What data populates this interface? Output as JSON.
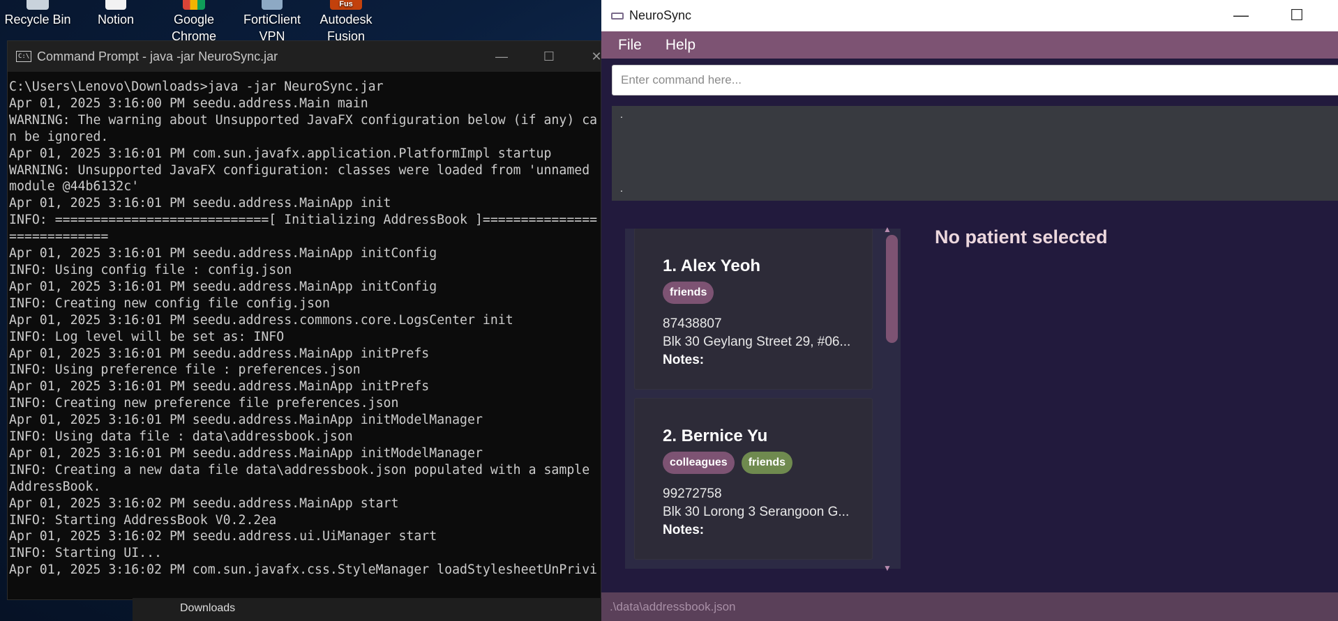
{
  "desktop": {
    "icons": [
      {
        "label": "Recycle Bin",
        "name": "recycle-bin-icon"
      },
      {
        "label": "Notion",
        "name": "notion-icon"
      },
      {
        "label": "Google Chrome",
        "line1": "Google",
        "line2": "Chrome",
        "name": "chrome-icon"
      },
      {
        "label": "FortiClient VPN",
        "line1": "FortiClient",
        "line2": "VPN",
        "name": "forticlient-icon"
      },
      {
        "label": "Autodesk Fusion",
        "line1": "Autodesk",
        "line2": "Fusion",
        "badge": "Fus",
        "name": "fusion-icon"
      }
    ]
  },
  "cmd": {
    "title": "Command Prompt - java  -jar NeuroSync.jar",
    "lines": [
      "C:\\Users\\Lenovo\\Downloads>java -jar NeuroSync.jar",
      "Apr 01, 2025 3:16:00 PM seedu.address.Main main",
      "WARNING: The warning about Unsupported JavaFX configuration below (if any) ca",
      "n be ignored.",
      "Apr 01, 2025 3:16:01 PM com.sun.javafx.application.PlatformImpl startup",
      "WARNING: Unsupported JavaFX configuration: classes were loaded from 'unnamed",
      "module @44b6132c'",
      "Apr 01, 2025 3:16:01 PM seedu.address.MainApp init",
      "INFO: ============================[ Initializing AddressBook ]===============",
      "=============",
      "Apr 01, 2025 3:16:01 PM seedu.address.MainApp initConfig",
      "INFO: Using config file : config.json",
      "Apr 01, 2025 3:16:01 PM seedu.address.MainApp initConfig",
      "INFO: Creating new config file config.json",
      "Apr 01, 2025 3:16:01 PM seedu.address.commons.core.LogsCenter init",
      "INFO: Log level will be set as: INFO",
      "Apr 01, 2025 3:16:01 PM seedu.address.MainApp initPrefs",
      "INFO: Using preference file : preferences.json",
      "Apr 01, 2025 3:16:01 PM seedu.address.MainApp initPrefs",
      "INFO: Creating new preference file preferences.json",
      "Apr 01, 2025 3:16:01 PM seedu.address.MainApp initModelManager",
      "INFO: Using data file : data\\addressbook.json",
      "Apr 01, 2025 3:16:01 PM seedu.address.MainApp initModelManager",
      "INFO: Creating a new data file data\\addressbook.json populated with a sample",
      "AddressBook.",
      "Apr 01, 2025 3:16:02 PM seedu.address.MainApp start",
      "INFO: Starting AddressBook V0.2.2ea",
      "Apr 01, 2025 3:16:02 PM seedu.address.ui.UiManager start",
      "INFO: Starting UI...",
      "Apr 01, 2025 3:16:02 PM com.sun.javafx.css.StyleManager loadStylesheetUnPrivi"
    ],
    "taskbar_label": "Downloads"
  },
  "app": {
    "title": "NeuroSync",
    "menu": {
      "file": "File",
      "help": "Help"
    },
    "command_placeholder": "Enter command here...",
    "result_text_top": ".",
    "result_text_bottom": ".",
    "persons": [
      {
        "index": "1.",
        "name": "Alex Yeoh",
        "title": "1.  Alex Yeoh",
        "tags": [
          {
            "label": "friends",
            "color": "#7d5373"
          }
        ],
        "phone": "87438807",
        "address": "Blk 30 Geylang Street 29, #06...",
        "notes_label": "Notes:"
      },
      {
        "index": "2.",
        "name": "Bernice Yu",
        "title": "2.  Bernice Yu",
        "tags": [
          {
            "label": "colleagues",
            "color": "#7d5373"
          },
          {
            "label": "friends",
            "color": "#6f8a4f"
          }
        ],
        "phone": "99272758",
        "address": "Blk 30 Lorong 3 Serangoon G...",
        "notes_label": "Notes:"
      }
    ],
    "detail_placeholder": "No patient selected",
    "status_bar_path": ".\\data\\addressbook.json",
    "colors": {
      "accent": "#7d5373",
      "background": "#221a3d",
      "tag_green": "#6f8a4f"
    }
  }
}
